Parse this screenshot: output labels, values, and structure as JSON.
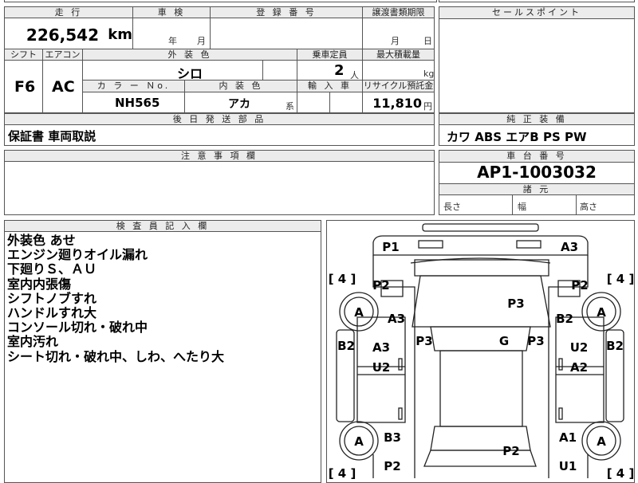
{
  "headers": {
    "mileage": "走 行",
    "inspection": "車 検",
    "registration_no": "登 録 番 号",
    "transfer_doc": "譲渡書類期限",
    "sales_point": "セールスポイント",
    "shift": "シフト",
    "aircon": "エアコン",
    "exterior_color": "外 装 色",
    "capacity": "乗車定員",
    "max_load": "最大積載量",
    "color_no": "カ ラ ー Ｎo.",
    "interior_color": "内 装 色",
    "import": "輸 入 車",
    "recycle": "リサイクル預託金",
    "later_parts": "後 日 発 送 部 品",
    "equipment": "純 正 装 備",
    "notes": "注 意 事 項 欄",
    "chassis_no": "車 台 番 号",
    "dimensions": "諸 元",
    "inspector_notes": "検 査 員 記 入 欄"
  },
  "vehicle": {
    "mileage_value": "226,542",
    "mileage_unit": "km",
    "inspection_year": "年",
    "inspection_month": "月",
    "transfer_month": "月",
    "transfer_day": "日",
    "shift": "F6",
    "aircon": "AC",
    "exterior_color": "シロ",
    "capacity_value": "2",
    "capacity_unit": "人",
    "load_unit": "kg",
    "color_no": "NH565",
    "interior_color": "アカ",
    "interior_suffix": "系",
    "recycle_value": "11,810",
    "recycle_unit": "円",
    "later_parts": "保証書 車両取説",
    "equipment": "カワ ABS エアB PS PW",
    "chassis_no": "AP1-1003032",
    "dim_length": "長さ",
    "dim_width": "幅",
    "dim_height": "高さ"
  },
  "remarks": [
    "外装色 あせ",
    "エンジン廻りオイル漏れ",
    "下廻りＳ、ＡＵ",
    "室内内張傷",
    "シフトノブすれ",
    "ハンドルすれ大",
    "コンソール切れ・破れ中",
    "室内汚れ",
    "シート切れ・破れ中、しわ、へたり大"
  ],
  "diagram": {
    "tread_label": "[ 4 ]",
    "wheel_label": "A",
    "damage_marks": [
      "P1",
      "A3",
      "P2",
      "P2",
      "P3",
      "A3",
      "B2",
      "B2",
      "P3",
      "G",
      "P3",
      "A3",
      "U2",
      "B2",
      "U2",
      "A2",
      "B3",
      "A1",
      "P2",
      "P2",
      "U1"
    ]
  }
}
